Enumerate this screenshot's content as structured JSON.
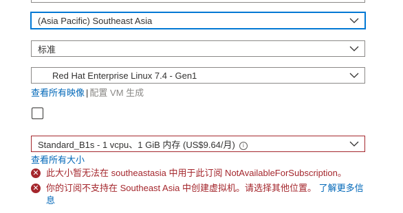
{
  "region": {
    "value": "(Asia Pacific) Southeast Asia"
  },
  "availability": {
    "value": "标准"
  },
  "image": {
    "value": "Red Hat Enterprise Linux 7.4 - Gen1"
  },
  "image_links": {
    "see_all": "查看所有映像",
    "separator": "|",
    "configure": "配置 VM 生成"
  },
  "size": {
    "value": "Standard_B1s - 1 vcpu、1 GiB 内存 (US$9.64/月)",
    "info_icon": "info-icon"
  },
  "size_links": {
    "see_all": "查看所有大小"
  },
  "errors": [
    {
      "text": "此大小暂无法在 southeastasia 中用于此订阅 NotAvailableForSubscription。"
    },
    {
      "text": "你的订阅不支持在 Southeast Asia 中创建虚拟机。请选择其他位置。",
      "link": "了解更多信息"
    }
  ],
  "colors": {
    "link": "#0067b8",
    "error": "#a4262c",
    "focus": "#0078d4",
    "border": "#8a8886"
  }
}
